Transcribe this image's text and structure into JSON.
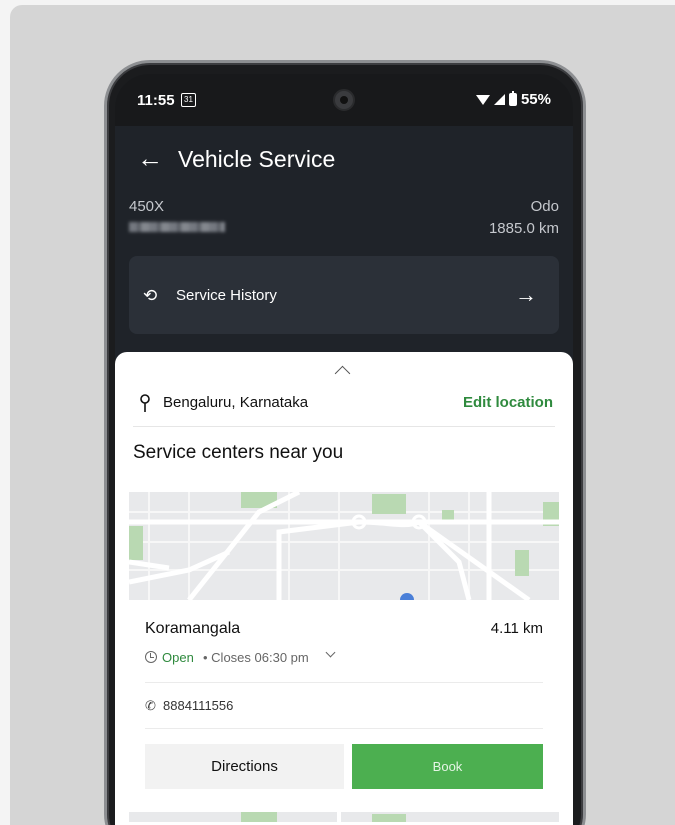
{
  "status_bar": {
    "time": "11:55",
    "calendar_day": "31",
    "battery": "55%"
  },
  "header": {
    "title": "Vehicle Service"
  },
  "vehicle": {
    "model": "450X",
    "odo_label": "Odo",
    "odo_value": "1885.0 km"
  },
  "service_history": {
    "label": "Service History"
  },
  "location": {
    "city": "Bengaluru, Karnataka",
    "edit_label": "Edit location"
  },
  "section_title": "Service centers near you",
  "service_center": {
    "name": "Koramangala",
    "distance": "4.11 km",
    "open_status": "Open",
    "closes": "• Closes 06:30 pm",
    "phone": "8884111556",
    "directions_label": "Directions",
    "book_label": "Book"
  },
  "colors": {
    "accent_green": "#4caf50",
    "header_bg": "#1f2329"
  }
}
